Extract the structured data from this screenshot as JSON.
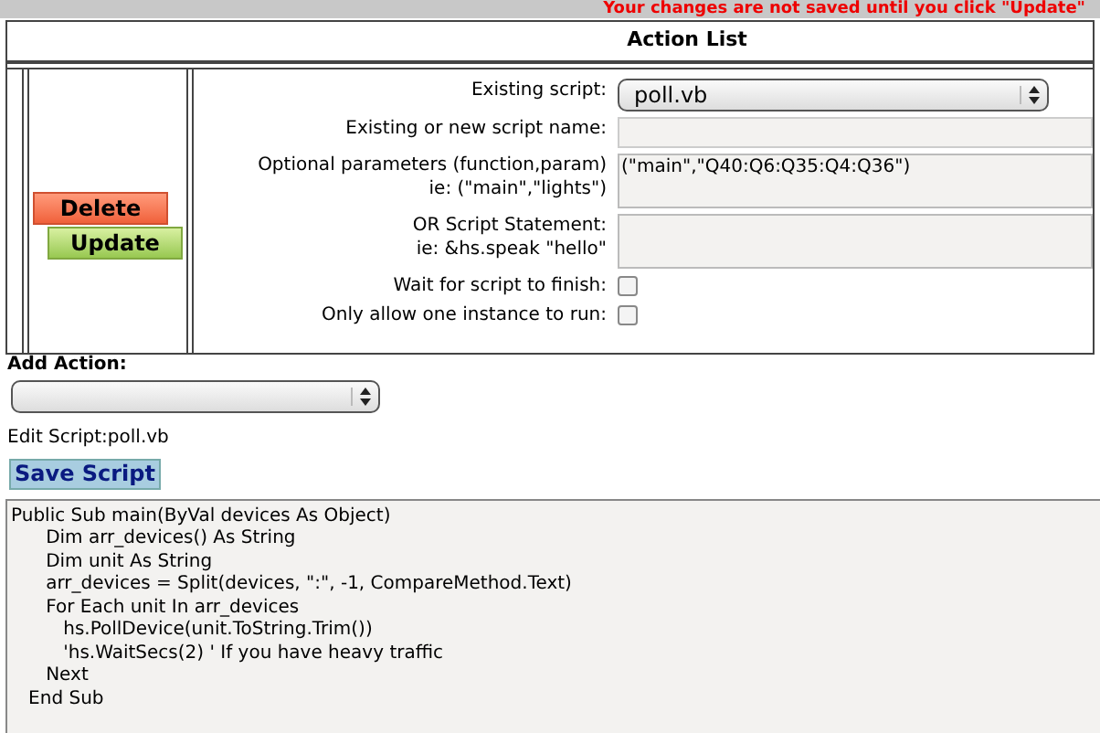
{
  "notice": "Your changes are not saved until you click \"Update\"",
  "action_list": {
    "title": "Action List",
    "buttons": [
      {
        "kind": "delete",
        "label": "Delete"
      },
      {
        "kind": "update",
        "label": "Update"
      }
    ],
    "fields": [
      {
        "kind": "select",
        "label": "Existing script:",
        "value": "poll.vb"
      },
      {
        "kind": "input",
        "label": "Existing or new script name:"
      },
      {
        "kind": "textarea",
        "label": "Optional parameters (function,param)",
        "hint": "ie: (\"main\",\"lights\")",
        "value": "(\"main\",\"Q40:Q6:Q35:Q4:Q36\")"
      },
      {
        "kind": "textarea",
        "label": "OR Script Statement:",
        "hint": "ie: &hs.speak \"hello\""
      },
      {
        "kind": "checkbox",
        "label": "Wait for script to finish:",
        "checked": false
      },
      {
        "kind": "checkbox",
        "label": "Only allow one instance to run:",
        "checked": false
      }
    ]
  },
  "add_action": {
    "label": "Add Action:"
  },
  "edit_script": {
    "label": "Edit Script:poll.vb",
    "save_button": "Save Script",
    "code": [
      "Public Sub main(ByVal devices As Object)",
      "      Dim arr_devices() As String",
      "      Dim unit As String",
      "      arr_devices = Split(devices, \":\", -1, CompareMethod.Text)",
      "      For Each unit In arr_devices",
      "         hs.PollDevice(unit.ToString.Trim())",
      "         'hs.WaitSecs(2) ' If you have heavy traffic",
      "      Next",
      "   End Sub"
    ]
  }
}
